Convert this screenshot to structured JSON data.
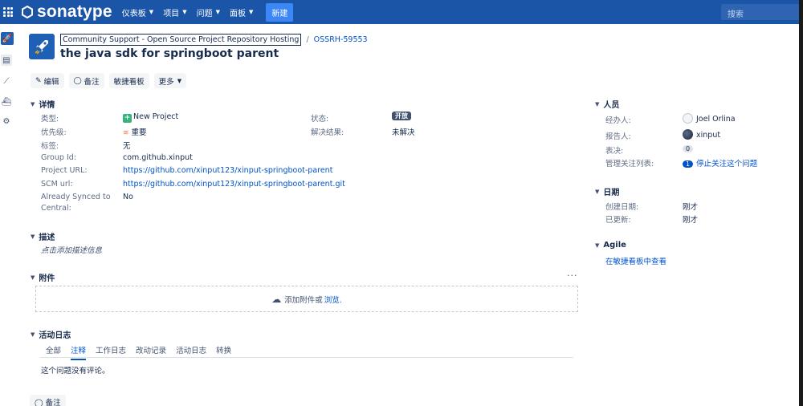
{
  "topbar": {
    "brand": "sonatype",
    "nav": [
      "仪表板",
      "项目",
      "问题",
      "面板"
    ],
    "create_label": "新建",
    "search_placeholder": "搜索"
  },
  "issue": {
    "project": "Community Support - Open Source Project Repository Hosting",
    "separator": "/",
    "key": "OSSRH-59553",
    "title": "the java sdk for springboot parent"
  },
  "toolbar": {
    "edit": "编辑",
    "comment": "备注",
    "agile": "敏捷看板",
    "more": "更多"
  },
  "details": {
    "heading": "详情",
    "type_label": "类型:",
    "type_value": "New Project",
    "priority_label": "优先级:",
    "priority_value": "重要",
    "labels_label": "标签:",
    "labels_value": "无",
    "group_label": "Group Id:",
    "group_value": "com.github.xinput",
    "project_url_label": "Project URL:",
    "project_url_value": "https://github.com/xinput123/xinput-springboot-parent",
    "scm_label": "SCM url:",
    "scm_value": "https://github.com/xinput123/xinput-springboot-parent.git",
    "synced_label_1": "Already Synced to",
    "synced_label_2": "Central:",
    "synced_value": "No",
    "status_label": "状态:",
    "status_value": "开放",
    "resolution_label": "解决结果:",
    "resolution_value": "未解决"
  },
  "description": {
    "heading": "描述",
    "placeholder": "点击添加描述信息"
  },
  "attachments": {
    "heading": "附件",
    "more": "···",
    "drop_text": "添加附件或",
    "browse": "浏览."
  },
  "activity": {
    "heading": "活动日志",
    "tabs": [
      "全部",
      "注释",
      "工作日志",
      "改动记录",
      "活动日志",
      "转换"
    ],
    "active_tab": "注释",
    "empty": "这个问题没有评论。",
    "comment_button": "备注"
  },
  "people": {
    "heading": "人员",
    "assignee_label": "经办人:",
    "assignee_value": "Joel Orlina",
    "reporter_label": "报告人:",
    "reporter_value": "xinput",
    "votes_label": "表决:",
    "votes_value": "0",
    "watchers_label": "管理关注列表:",
    "watchers_count": "1",
    "watchers_link": "停止关注这个问题"
  },
  "dates": {
    "heading": "日期",
    "created_label": "创建日期:",
    "created_value": "刚才",
    "updated_label": "已更新:",
    "updated_value": "刚才"
  },
  "agile": {
    "heading": "Agile",
    "link": "在敏捷看板中查看"
  },
  "colors": {
    "topbar": "#1b55a8",
    "link": "#0052cc",
    "create": "#3b87f5"
  }
}
